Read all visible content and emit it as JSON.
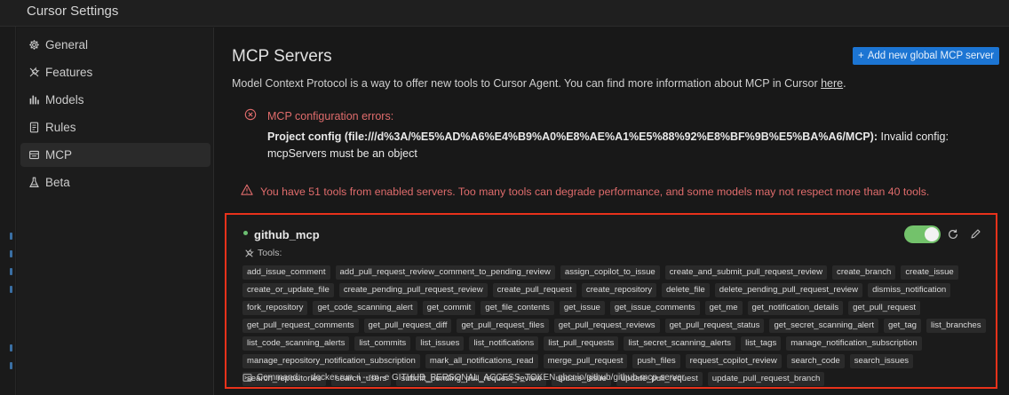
{
  "window": {
    "title": "Cursor Settings"
  },
  "sidebar": {
    "items": [
      {
        "label": "General",
        "icon": "gear-icon"
      },
      {
        "label": "Features",
        "icon": "tools-icon"
      },
      {
        "label": "Models",
        "icon": "bar-chart-icon"
      },
      {
        "label": "Rules",
        "icon": "document-icon"
      },
      {
        "label": "MCP",
        "icon": "mcp-icon",
        "active": true
      },
      {
        "label": "Beta",
        "icon": "flask-icon"
      }
    ]
  },
  "main": {
    "heading": "MCP Servers",
    "add_button_label": "Add new global MCP server",
    "description_text": "Model Context Protocol is a way to offer new tools to Cursor Agent. You can find more information about MCP in Cursor ",
    "description_link": "here",
    "description_end": ".",
    "error": {
      "title": "MCP configuration errors:",
      "source": "Project config (file:///d%3A/%E5%AD%A6%E4%B9%A0%E8%AE%A1%E5%88%92%E8%BF%9B%E5%BA%A6/MCP):",
      "message": " Invalid config: mcpServers must be an object"
    },
    "warning": "You have 51 tools from enabled servers. Too many tools can degrade performance, and some models may not respect more than 40 tools.",
    "server": {
      "name": "github_mcp",
      "enabled": true,
      "tools_label": "Tools:",
      "tools": [
        "add_issue_comment",
        "add_pull_request_review_comment_to_pending_review",
        "assign_copilot_to_issue",
        "create_and_submit_pull_request_review",
        "create_branch",
        "create_issue",
        "create_or_update_file",
        "create_pending_pull_request_review",
        "create_pull_request",
        "create_repository",
        "delete_file",
        "delete_pending_pull_request_review",
        "dismiss_notification",
        "fork_repository",
        "get_code_scanning_alert",
        "get_commit",
        "get_file_contents",
        "get_issue",
        "get_issue_comments",
        "get_me",
        "get_notification_details",
        "get_pull_request",
        "get_pull_request_comments",
        "get_pull_request_diff",
        "get_pull_request_files",
        "get_pull_request_reviews",
        "get_pull_request_status",
        "get_secret_scanning_alert",
        "get_tag",
        "list_branches",
        "list_code_scanning_alerts",
        "list_commits",
        "list_issues",
        "list_notifications",
        "list_pull_requests",
        "list_secret_scanning_alerts",
        "list_tags",
        "manage_notification_subscription",
        "manage_repository_notification_subscription",
        "mark_all_notifications_read",
        "merge_pull_request",
        "push_files",
        "request_copilot_review",
        "search_code",
        "search_issues",
        "search_repositories",
        "search_users",
        "submit_pending_pull_request_review",
        "update_issue",
        "update_pull_request",
        "update_pull_request_branch"
      ],
      "command_label": "Command:",
      "command": "docker run -i --rm -e GITHUB_PERSONAL_ACCESS_TOKEN ghcr.io/github/github-mcp-server"
    }
  },
  "colors": {
    "accent": "#1c75d3",
    "error": "#e06c6c",
    "toggle_on": "#73c26b",
    "highlight_border": "#e8321b"
  }
}
